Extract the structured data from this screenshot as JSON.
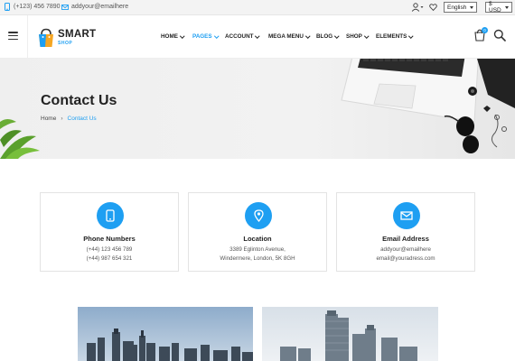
{
  "topbar": {
    "phone": "(+123) 456 7890",
    "email": "addyour@emailhere",
    "language": "English",
    "currency": "$ USD"
  },
  "logo": {
    "main": "SMART",
    "sub": "SHOP"
  },
  "nav": {
    "items": [
      {
        "label": "HOME",
        "active": false
      },
      {
        "label": "PAGES",
        "active": true
      },
      {
        "label": "ACCOUNT",
        "active": false
      },
      {
        "label": "MEGA MENU",
        "active": false
      },
      {
        "label": "BLOG",
        "active": false
      },
      {
        "label": "SHOP",
        "active": false
      },
      {
        "label": "ELEMENTS",
        "active": false
      }
    ]
  },
  "cart": {
    "count": "0"
  },
  "hero": {
    "title": "Contact Us",
    "breadcrumb": {
      "home": "Home",
      "current": "Contact Us"
    }
  },
  "cards": [
    {
      "icon": "phone-icon",
      "title": "Phone Numbers",
      "line1": "(+44) 123 456 789",
      "line2": "(+44) 987 654 321"
    },
    {
      "icon": "location-pin-icon",
      "title": "Location",
      "line1": "3389 Eglinton Avenue,",
      "line2": "Windermere, London, 5K 8GH"
    },
    {
      "icon": "envelope-icon",
      "title": "Email Address",
      "line1": "addyour@emailhere",
      "line2": "email@youradress.com"
    }
  ],
  "colors": {
    "accent": "#1e9ff2",
    "topbar_bg": "#f3f3f3",
    "hero_bg": "#efefef"
  }
}
